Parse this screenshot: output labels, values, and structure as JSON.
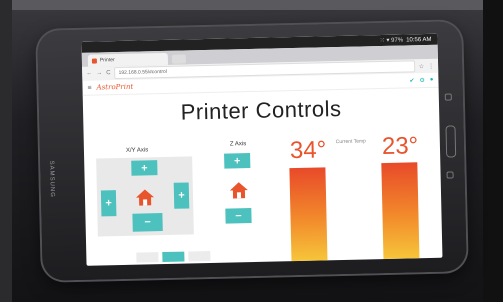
{
  "statusbar": {
    "icons": "⁙ ▾ 97%",
    "time": "10:56 AM"
  },
  "browser": {
    "tab_title": "Printer",
    "url": "192.168.0.55/#control"
  },
  "app": {
    "logo": "AstroPrint"
  },
  "page": {
    "title": "Printer Controls"
  },
  "controls": {
    "xy_label": "X/Y Axis",
    "z_label": "Z Axis",
    "up_glyph": "+",
    "down_glyph": "−",
    "left_glyph": "+",
    "right_glyph": "+"
  },
  "temperatures": {
    "nozzle_value": "34°",
    "bed_value": "23°",
    "current_label": "Current Temp"
  },
  "device": {
    "brand": "SAMSUNG"
  },
  "colors": {
    "accent": "#4cc1bd",
    "brand": "#e8542b"
  }
}
